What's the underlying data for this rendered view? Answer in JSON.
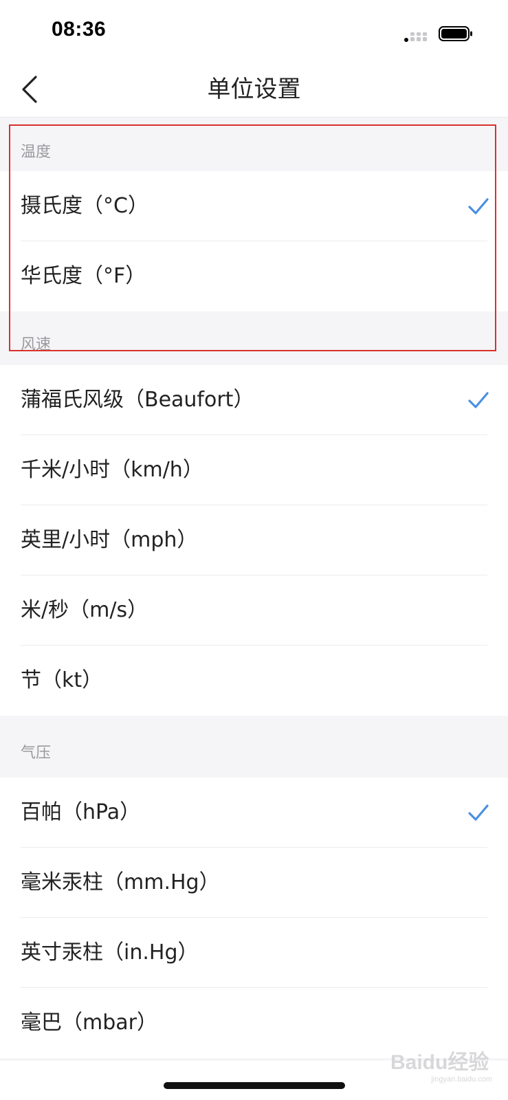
{
  "status_bar": {
    "time": "08:36"
  },
  "nav": {
    "title": "单位设置",
    "back_icon": "chevron-left-icon"
  },
  "accent_color": "#4a8fe2",
  "sections": {
    "temperature": {
      "header": "温度",
      "options": [
        {
          "label": "摄氏度（°C）",
          "selected": true
        },
        {
          "label": "华氏度（°F）",
          "selected": false
        }
      ]
    },
    "wind": {
      "header": "风速",
      "options": [
        {
          "label": "蒲福氏风级（Beaufort）",
          "selected": true
        },
        {
          "label": "千米/小时（km/h）",
          "selected": false
        },
        {
          "label": "英里/小时（mph）",
          "selected": false
        },
        {
          "label": "米/秒（m/s）",
          "selected": false
        },
        {
          "label": "节（kt）",
          "selected": false
        }
      ]
    },
    "pressure": {
      "header": "气压",
      "options": [
        {
          "label": "百帕（hPa）",
          "selected": true
        },
        {
          "label": "毫米汞柱（mm.Hg）",
          "selected": false
        },
        {
          "label": "英寸汞柱（in.Hg）",
          "selected": false
        },
        {
          "label": "毫巴（mbar）",
          "selected": false
        }
      ]
    }
  },
  "watermark": {
    "text": "Baidu经验",
    "sub": "jingyan.baidu.com"
  }
}
